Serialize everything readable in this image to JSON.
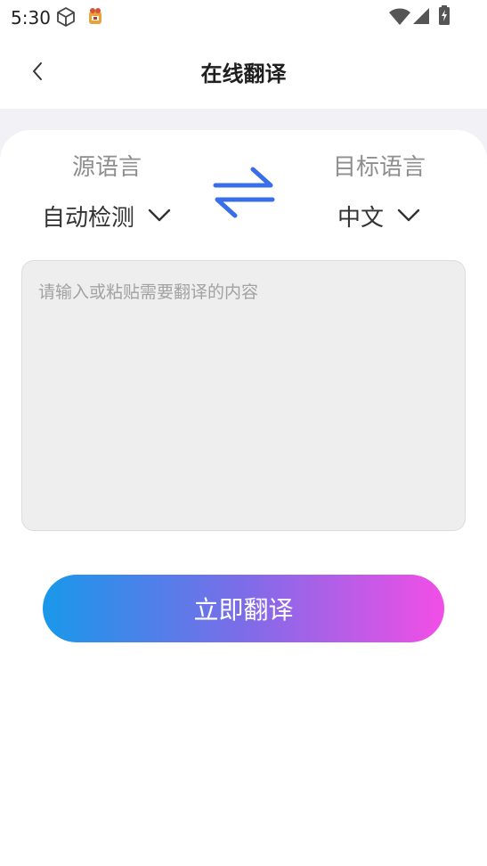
{
  "status_bar": {
    "time": "5:30",
    "icons": [
      "cube-icon",
      "app-notification-icon",
      "wifi-icon",
      "signal-icon",
      "battery-charging-icon"
    ]
  },
  "nav": {
    "title": "在线翻译",
    "back_icon": "chevron-left-icon"
  },
  "source_language": {
    "caption": "源语言",
    "value": "自动检测"
  },
  "target_language": {
    "caption": "目标语言",
    "value": "中文"
  },
  "swap_icon": "swap-arrows-icon",
  "input": {
    "placeholder": "请输入或粘贴需要翻译的内容",
    "value": ""
  },
  "translate_button": {
    "label": "立即翻译"
  },
  "colors": {
    "accent_blue": "#3a6ee8",
    "gradient_start": "#1898ea",
    "gradient_mid": "#7d6ce8",
    "gradient_end": "#f24ee6",
    "page_strip": "#f2f2f6",
    "input_bg": "#eeeeee"
  }
}
